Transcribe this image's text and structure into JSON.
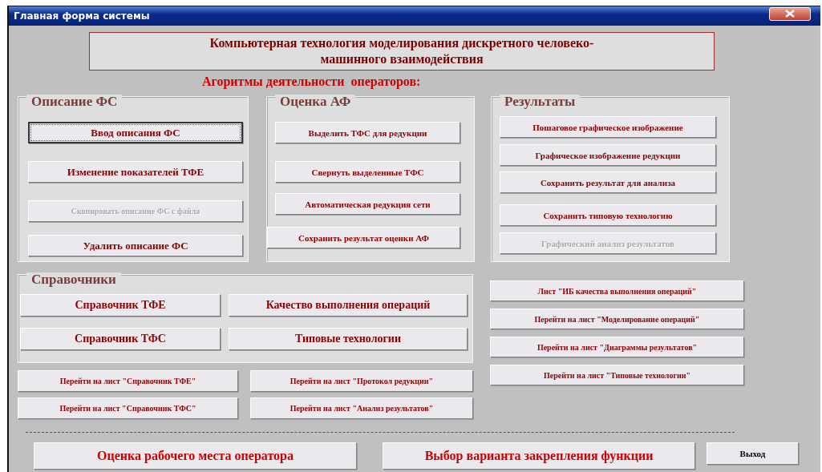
{
  "window": {
    "title": "Главная форма системы"
  },
  "header": {
    "text": "Компьютерная технология моделирования дискретного человеко-\nмашинного взаимодействия"
  },
  "subtitle": "Агоритмы деятельности  операторов:",
  "groups": [
    {
      "title": "Описание ФС",
      "buttons": [
        {
          "label": "Ввод описания ФС",
          "disabled": false,
          "focused": true
        },
        {
          "label": "Изменение показателей ТФЕ",
          "disabled": false,
          "focused": false
        },
        {
          "label": "Скопировать описание ФС с файла",
          "disabled": true,
          "focused": false
        },
        {
          "label": "Удалить описание ФС",
          "disabled": false,
          "focused": false
        }
      ]
    },
    {
      "title": "Оценка АФ",
      "buttons": [
        {
          "label": "Выделить ТФС для редукции",
          "disabled": false,
          "focused": false
        },
        {
          "label": "Свернуть выделенные ТФС",
          "disabled": false,
          "focused": false
        },
        {
          "label": "Автоматическая редукция сети",
          "disabled": false,
          "focused": false
        },
        {
          "label": "Сохранить результат оценки АФ",
          "disabled": false,
          "focused": false
        }
      ]
    },
    {
      "title": "Результаты",
      "buttons": [
        {
          "label": "Пошаговое графическое изображение",
          "disabled": false,
          "focused": false
        },
        {
          "label": "Графическое изображение редукции",
          "disabled": false,
          "focused": false
        },
        {
          "label": "Сохранить результат для анализа",
          "disabled": false,
          "focused": false
        },
        {
          "label": "Сохранить типовую технологию",
          "disabled": false,
          "focused": false
        },
        {
          "label": "Графический анализ результатов",
          "disabled": true,
          "focused": false
        }
      ]
    }
  ],
  "reference": {
    "title": "Справочники",
    "buttons": [
      "Справочник ТФЕ",
      "Качество выполнения операций",
      "Справочник ТФС",
      "Типовые технологии"
    ]
  },
  "nav_buttons": [
    "Перейти на лист \"Справочник ТФЕ\"",
    "Перейти на лист \"Протокол редукции\"",
    "Перейти на лист \"Справочник ТФС\"",
    "Перейти на лист \"Анализ результатов\""
  ],
  "sheet_buttons": [
    "Лист \"ИБ качества выполнения операций\"",
    "Перейти на лист \"Моделирование операций\"",
    "Перейти на лист \"Диаграммы результатов\"",
    "Перейти на лист \"Типовые технологии\""
  ],
  "bottom_buttons": [
    {
      "label": "Оценка рабочего места оператора",
      "kind": "accent"
    },
    {
      "label": "Выбор варианта закрепления функции",
      "kind": "accent"
    },
    {
      "label": "Выход",
      "kind": "plain"
    }
  ]
}
